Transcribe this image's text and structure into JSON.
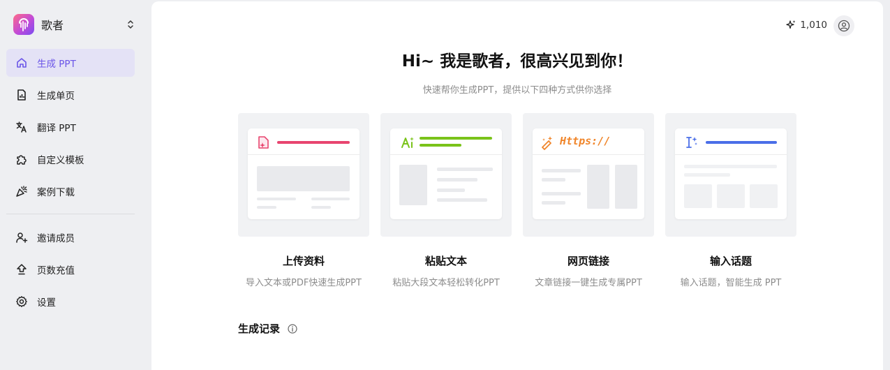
{
  "brand": {
    "name": "歌者"
  },
  "nav": {
    "main": [
      {
        "label": "生成 PPT",
        "icon": "home-icon",
        "active": true
      },
      {
        "label": "生成单页",
        "icon": "chart-doc-icon"
      },
      {
        "label": "翻译 PPT",
        "icon": "translate-icon"
      },
      {
        "label": "自定义模板",
        "icon": "puzzle-icon"
      },
      {
        "label": "案例下载",
        "icon": "party-icon"
      }
    ],
    "secondary": [
      {
        "label": "邀请成员",
        "icon": "add-user-icon"
      },
      {
        "label": "页数充值",
        "icon": "upgrade-icon"
      },
      {
        "label": "设置",
        "icon": "gear-icon"
      }
    ]
  },
  "header": {
    "credits": "1,010"
  },
  "hero": {
    "title": "Hi~ 我是歌者，很高兴见到你！",
    "subtitle": "快速帮你生成PPT，提供以下四种方式供你选择"
  },
  "cards": [
    {
      "title": "上传资料",
      "desc": "导入文本或PDF快速生成PPT"
    },
    {
      "title": "粘贴文本",
      "desc": "粘贴大段文本轻松转化PPT"
    },
    {
      "title": "网页链接",
      "desc": "文章链接一键生成专属PPT",
      "url_text": "Https://"
    },
    {
      "title": "输入话题",
      "desc": "输入话题，智能生成 PPT"
    }
  ],
  "history": {
    "title": "生成记录"
  },
  "colors": {
    "accent": "#6b55e8",
    "upload": "#e8456f",
    "paste": "#7ac31a",
    "link": "#f0852a",
    "topic": "#4a6ee8"
  }
}
